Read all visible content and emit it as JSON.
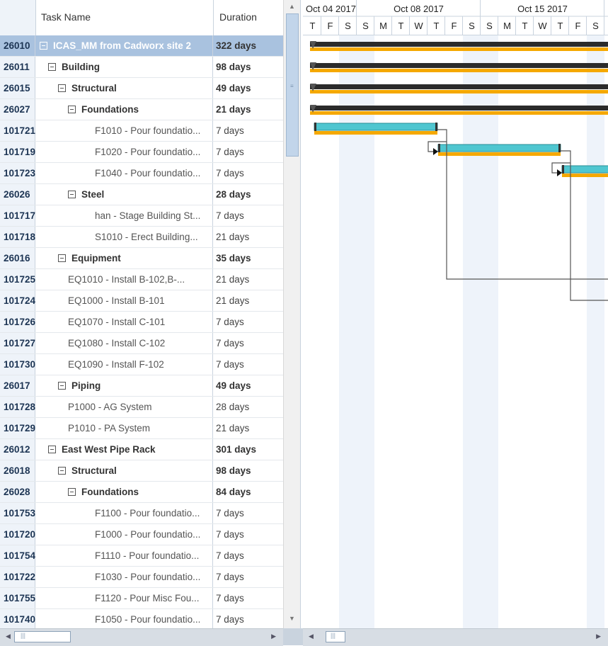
{
  "grid": {
    "columns": {
      "name": "Task Name",
      "duration": "Duration"
    },
    "rows": [
      {
        "id": "26010",
        "name": "ICAS_MM from Cadworx site 2",
        "duration": "322 days",
        "level": 0,
        "summary": true,
        "selected": true
      },
      {
        "id": "26011",
        "name": "Building",
        "duration": "98 days",
        "level": 1,
        "summary": true
      },
      {
        "id": "26015",
        "name": "Structural",
        "duration": "49 days",
        "level": 2,
        "summary": true
      },
      {
        "id": "26027",
        "name": "Foundations",
        "duration": "21 days",
        "level": 3,
        "summary": true
      },
      {
        "id": "101721",
        "name": "F1010 - Pour foundatio...",
        "duration": "7 days",
        "level": 4
      },
      {
        "id": "101719",
        "name": "F1020 - Pour foundatio...",
        "duration": "7 days",
        "level": 4
      },
      {
        "id": "101723",
        "name": "F1040 - Pour foundatio...",
        "duration": "7 days",
        "level": 4
      },
      {
        "id": "26026",
        "name": "Steel",
        "duration": "28 days",
        "level": 3,
        "summary": true
      },
      {
        "id": "101717",
        "name": "han - Stage Building St...",
        "duration": "7 days",
        "level": 4
      },
      {
        "id": "101718",
        "name": "S1010 - Erect Building...",
        "duration": "21 days",
        "level": 4
      },
      {
        "id": "26016",
        "name": "Equipment",
        "duration": "35 days",
        "level": 2,
        "summary": true
      },
      {
        "id": "101725",
        "name": "EQ1010 - Install B-102,B-...",
        "duration": "21 days",
        "level": 3
      },
      {
        "id": "101724",
        "name": "EQ1000 - Install B-101",
        "duration": "21 days",
        "level": 3
      },
      {
        "id": "101726",
        "name": "EQ1070 - Install C-101",
        "duration": "7 days",
        "level": 3
      },
      {
        "id": "101727",
        "name": "EQ1080 - Install C-102",
        "duration": "7 days",
        "level": 3
      },
      {
        "id": "101730",
        "name": "EQ1090 - Install F-102",
        "duration": "7 days",
        "level": 3
      },
      {
        "id": "26017",
        "name": "Piping",
        "duration": "49 days",
        "level": 2,
        "summary": true
      },
      {
        "id": "101728",
        "name": "P1000 - AG System",
        "duration": "28 days",
        "level": 3
      },
      {
        "id": "101729",
        "name": "P1010 - PA System",
        "duration": "21 days",
        "level": 3
      },
      {
        "id": "26012",
        "name": "East West Pipe Rack",
        "duration": "301 days",
        "level": 1,
        "summary": true
      },
      {
        "id": "26018",
        "name": "Structural",
        "duration": "98 days",
        "level": 2,
        "summary": true
      },
      {
        "id": "26028",
        "name": "Foundations",
        "duration": "84 days",
        "level": 3,
        "summary": true
      },
      {
        "id": "101753",
        "name": "F1100 - Pour foundatio...",
        "duration": "7 days",
        "level": 4
      },
      {
        "id": "101720",
        "name": "F1000 - Pour foundatio...",
        "duration": "7 days",
        "level": 4
      },
      {
        "id": "101754",
        "name": "F1110 - Pour foundatio...",
        "duration": "7 days",
        "level": 4
      },
      {
        "id": "101722",
        "name": "F1030 - Pour foundatio...",
        "duration": "7 days",
        "level": 4
      },
      {
        "id": "101755",
        "name": "F1120 - Pour Misc Fou...",
        "duration": "7 days",
        "level": 4
      },
      {
        "id": "101740",
        "name": "F1050 - Pour foundatio...",
        "duration": "7 days",
        "level": 4
      }
    ]
  },
  "gantt": {
    "months": [
      "Oct 04 2017",
      "Oct 08 2017",
      "Oct 15 2017"
    ],
    "days": [
      "T",
      "F",
      "S",
      "S",
      "M",
      "T",
      "W",
      "T",
      "F",
      "S",
      "S",
      "M",
      "T",
      "W",
      "T",
      "F",
      "S"
    ],
    "weekend_columns": [
      2,
      3,
      9,
      10,
      16
    ],
    "colors": {
      "summary_bar": "#2b2b2b",
      "baseline": "#f5a800",
      "task_bar": "#4fc6d0",
      "link": "#555555",
      "weekend": "#eef3fa"
    }
  }
}
